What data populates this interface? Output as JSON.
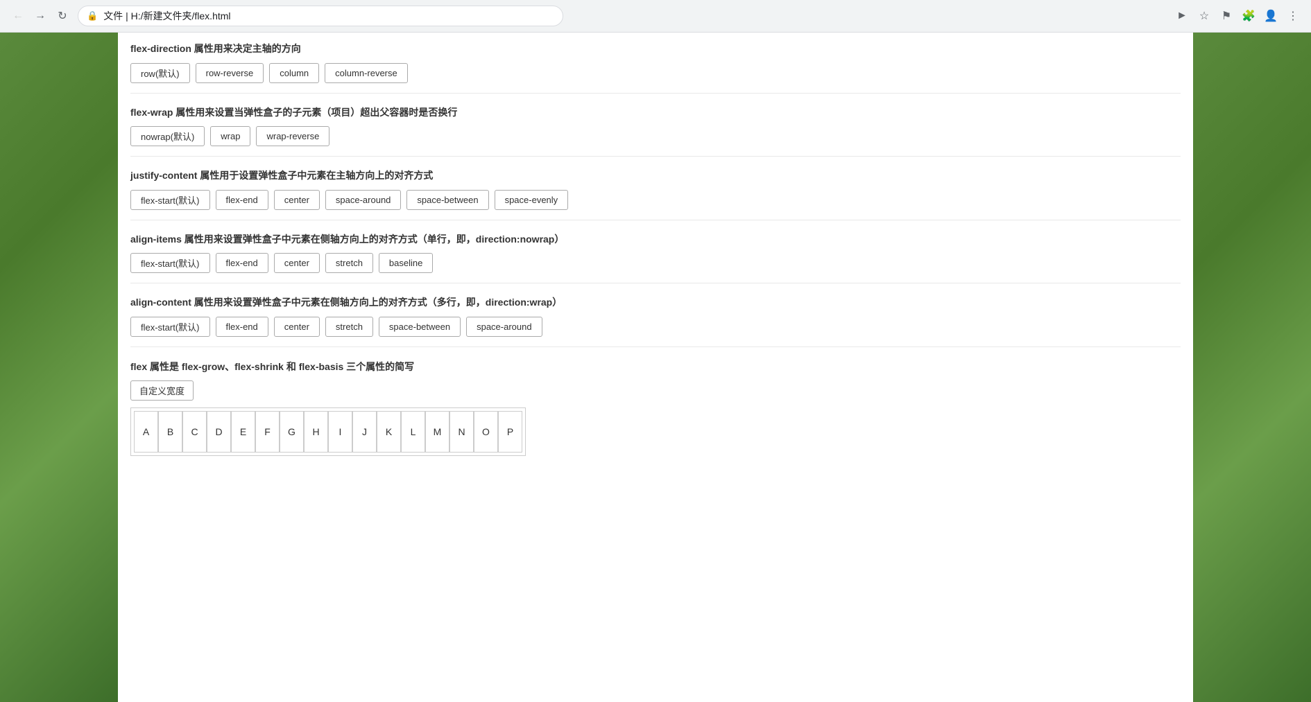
{
  "browser": {
    "back_disabled": true,
    "forward_disabled": false,
    "address_icon": "🔒",
    "file_prefix": "文件",
    "address": "H:/新建文件夹/flex.html",
    "toolbar_icons": [
      "▶",
      "☆",
      "⚑",
      "🧩",
      "👤",
      "⋮"
    ]
  },
  "sections": [
    {
      "id": "flex-direction",
      "title": "flex-direction 属性用来决定主轴的方向",
      "buttons": [
        "row(默认)",
        "row-reverse",
        "column",
        "column-reverse"
      ]
    },
    {
      "id": "flex-wrap",
      "title": "flex-wrap 属性用来设置当弹性盒子的子元素（项目）超出父容器时是否换行",
      "buttons": [
        "nowrap(默认)",
        "wrap",
        "wrap-reverse"
      ]
    },
    {
      "id": "justify-content",
      "title": "justify-content 属性用于设置弹性盒子中元素在主轴方向上的对齐方式",
      "buttons": [
        "flex-start(默认)",
        "flex-end",
        "center",
        "space-around",
        "space-between",
        "space-evenly"
      ]
    },
    {
      "id": "align-items",
      "title": "align-items 属性用来设置弹性盒子中元素在侧轴方向上的对齐方式（单行，即，direction:nowrap）",
      "buttons": [
        "flex-start(默认)",
        "flex-end",
        "center",
        "stretch",
        "baseline"
      ]
    },
    {
      "id": "align-content",
      "title": "align-content 属性用来设置弹性盒子中元素在侧轴方向上的对齐方式（多行，即，direction:wrap）",
      "buttons": [
        "flex-start(默认)",
        "flex-end",
        "center",
        "stretch",
        "space-between",
        "space-around"
      ]
    }
  ],
  "flex_section": {
    "title": "flex 属性是 flex-grow、flex-shrink 和 flex-basis 三个属性的简写",
    "custom_btn": "自定义宽度",
    "items": [
      "A",
      "B",
      "C",
      "D",
      "E",
      "F",
      "G",
      "H",
      "I",
      "J",
      "K",
      "L",
      "M",
      "N",
      "O",
      "P"
    ]
  }
}
